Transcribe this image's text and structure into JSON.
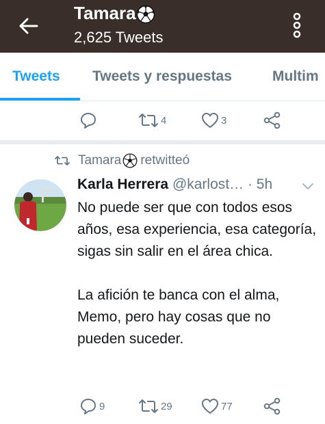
{
  "header": {
    "title": "Tamara",
    "title_emoji_icon": "soccer-ball-icon",
    "tweet_count": "2,625 Tweets",
    "back_icon": "arrow-left-icon",
    "more_icon": "vertical-dots-icon"
  },
  "tabs": [
    {
      "label": "Tweets",
      "active": true
    },
    {
      "label": "Tweets y respuestas",
      "active": false
    },
    {
      "label": "Multim",
      "active": false
    }
  ],
  "prev_tweet_actions": {
    "reply_count": "",
    "retweet_count": "4",
    "like_count": "3"
  },
  "retweet_notice": {
    "user": "Tamara",
    "suffix": "retwitteó"
  },
  "tweet": {
    "author": "Karla Herrera",
    "handle": "@karlost…",
    "time": " · 5h",
    "paragraphs": [
      "No puede ser que con todos esos años, esa experiencia, esa categoría, sigas sin salir en el área chica.",
      "La afición te banca con el alma, Memo, pero hay cosas que no pueden suceder."
    ],
    "reply_count": "9",
    "retweet_count": "29",
    "like_count": "77"
  },
  "colors": {
    "header_bg": "#3a2e2b",
    "accent": "#1da1f2",
    "muted": "#657786",
    "divider": "#e6ecf0"
  }
}
